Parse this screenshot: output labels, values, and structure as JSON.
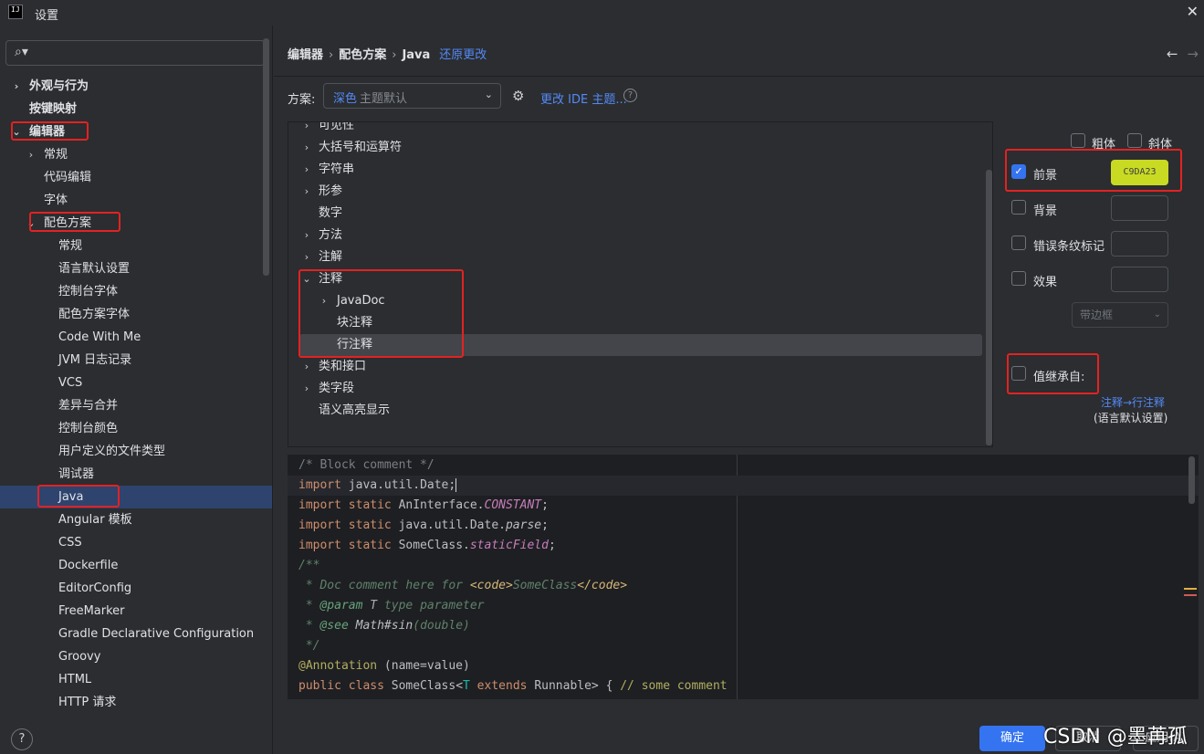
{
  "window": {
    "title": "设置",
    "logo_text": "IJ",
    "close_glyph": "✕"
  },
  "search": {
    "placeholder": "",
    "icon": "search-icon",
    "glyph": "⌕▾"
  },
  "sidebar": {
    "items": [
      {
        "label": "外观与行为",
        "chevron": "›",
        "bold": true
      },
      {
        "label": "按键映射",
        "chevron": "",
        "bold": true
      },
      {
        "label": "编辑器",
        "chevron": "⌄",
        "bold": true
      },
      {
        "label": "常规",
        "chevron": "›"
      },
      {
        "label": "代码编辑",
        "chevron": ""
      },
      {
        "label": "字体",
        "chevron": ""
      },
      {
        "label": "配色方案",
        "chevron": "⌄"
      },
      {
        "label": "常规",
        "chevron": ""
      },
      {
        "label": "语言默认设置",
        "chevron": ""
      },
      {
        "label": "控制台字体",
        "chevron": ""
      },
      {
        "label": "配色方案字体",
        "chevron": ""
      },
      {
        "label": "Code With Me",
        "chevron": ""
      },
      {
        "label": "JVM 日志记录",
        "chevron": ""
      },
      {
        "label": "VCS",
        "chevron": ""
      },
      {
        "label": "差异与合并",
        "chevron": ""
      },
      {
        "label": "控制台颜色",
        "chevron": ""
      },
      {
        "label": "用户定义的文件类型",
        "chevron": ""
      },
      {
        "label": "调试器",
        "chevron": ""
      },
      {
        "label": "Java",
        "chevron": "",
        "selected": true
      },
      {
        "label": "Angular 模板",
        "chevron": ""
      },
      {
        "label": "CSS",
        "chevron": ""
      },
      {
        "label": "Dockerfile",
        "chevron": ""
      },
      {
        "label": "EditorConfig",
        "chevron": ""
      },
      {
        "label": "FreeMarker",
        "chevron": ""
      },
      {
        "label": "Gradle Declarative Configuration",
        "chevron": ""
      },
      {
        "label": "Groovy",
        "chevron": ""
      },
      {
        "label": "HTML",
        "chevron": ""
      },
      {
        "label": "HTTP 请求",
        "chevron": ""
      }
    ],
    "help": "?"
  },
  "breadcrumb": {
    "items": [
      "编辑器",
      "配色方案",
      "Java"
    ],
    "separator": "›",
    "restore": "还原更改"
  },
  "nav": {
    "back": "←",
    "forward": "→"
  },
  "scheme": {
    "label": "方案:",
    "value": "深色",
    "value_hint": "主题默认",
    "dropdown": "⌄",
    "gear": "⚙",
    "change_theme": "更改 IDE 主题...",
    "help": "?"
  },
  "element_tree": {
    "items": [
      {
        "label": "可见性",
        "chevron": "›"
      },
      {
        "label": "大括号和运算符",
        "chevron": "›"
      },
      {
        "label": "字符串",
        "chevron": "›"
      },
      {
        "label": "形参",
        "chevron": "›"
      },
      {
        "label": "数字",
        "chevron": ""
      },
      {
        "label": "方法",
        "chevron": "›"
      },
      {
        "label": "注解",
        "chevron": "›"
      },
      {
        "label": "注释",
        "chevron": "⌄"
      },
      {
        "label": "JavaDoc",
        "chevron": "›"
      },
      {
        "label": "块注释",
        "chevron": ""
      },
      {
        "label": "行注释",
        "chevron": "",
        "selected": true
      },
      {
        "label": "类和接口",
        "chevron": "›"
      },
      {
        "label": "类字段",
        "chevron": "›"
      },
      {
        "label": "语义高亮显示",
        "chevron": ""
      }
    ]
  },
  "attributes": {
    "bold": {
      "label": "粗体",
      "checked": false
    },
    "italic": {
      "label": "斜体",
      "checked": false
    },
    "foreground": {
      "label": "前景",
      "checked": true,
      "color_hex": "C9DA23",
      "color": "#c9da23"
    },
    "background": {
      "label": "背景",
      "checked": false
    },
    "error_stripe": {
      "label": "错误条纹标记",
      "checked": false
    },
    "effects": {
      "label": "效果",
      "checked": false,
      "select_value": "带边框",
      "dropdown": "⌄"
    },
    "inherit": {
      "label": "值继承自:",
      "checked": false,
      "link": "注释→行注释",
      "sub": "(语言默认设置)"
    }
  },
  "code_preview": {
    "lines": [
      "/* Block comment */",
      "import java.util.Date;",
      "import static AnInterface.CONSTANT;",
      "import static java.util.Date.parse;",
      "import static SomeClass.staticField;",
      "/**",
      " * Doc comment here for <code>SomeClass</code>",
      " * @param T type parameter",
      " * @see Math#sin(double)",
      " */",
      "@Annotation (name=value)",
      "public class SomeClass<T extends Runnable> { // some comment"
    ]
  },
  "buttons": {
    "ok": "确定",
    "cancel": "取消",
    "apply": "应用(A)"
  },
  "watermark": "CSDN @墨苒孤",
  "colors": {
    "accent": "#3574f0",
    "link": "#548af7",
    "selection": "#2e436e",
    "annotation_red": "#e32222"
  }
}
